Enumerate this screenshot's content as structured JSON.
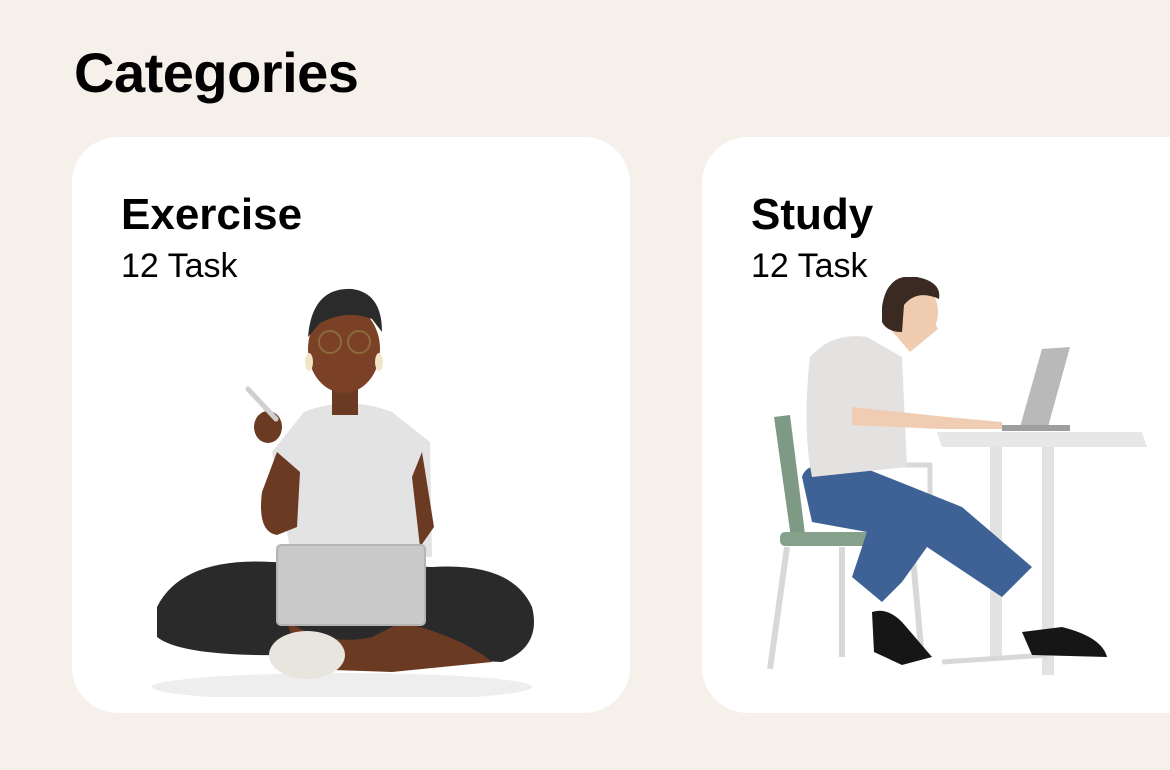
{
  "header": {
    "title": "Categories"
  },
  "categories": [
    {
      "title": "Exercise",
      "count_label": "12 Task",
      "illustration": "person-sitting-with-laptop"
    },
    {
      "title": "Study",
      "count_label": "12 Task",
      "illustration": "person-studying-at-desk"
    }
  ],
  "colors": {
    "background": "#f6f0ea",
    "card": "#ffffff",
    "text": "#000000"
  }
}
